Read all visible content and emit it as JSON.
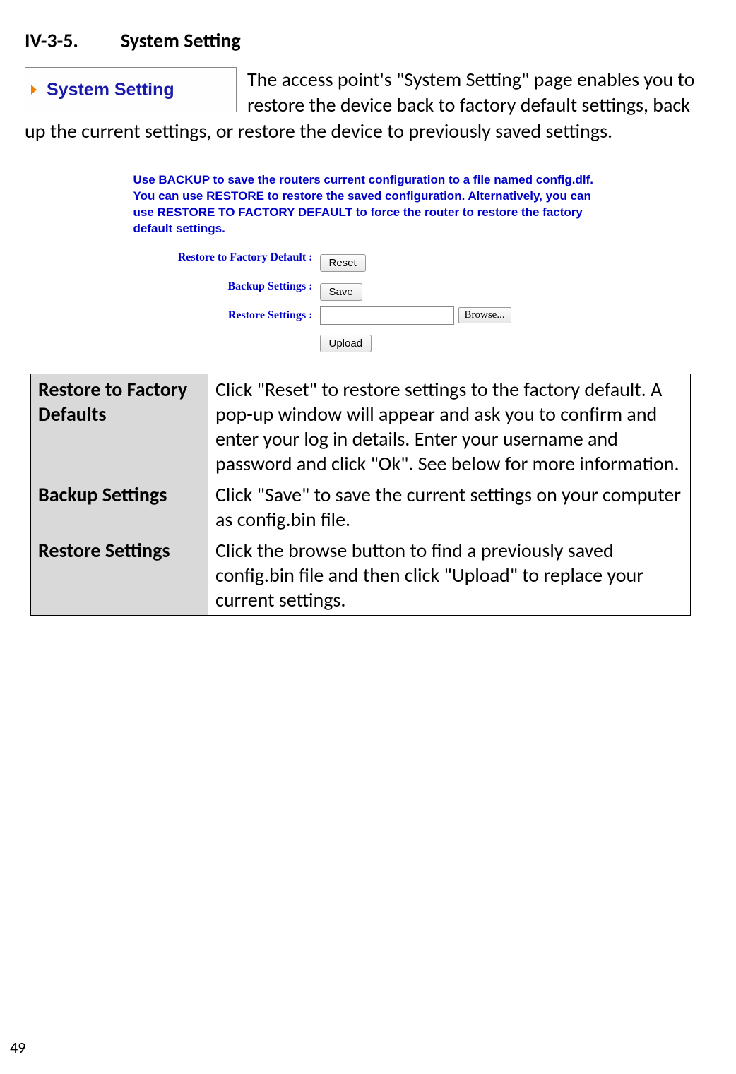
{
  "heading": {
    "num": "IV-3-5.",
    "title": "System Setting"
  },
  "box": {
    "label": "System Setting"
  },
  "intro": "The access point's \"System Setting\" page enables you to restore the device back to factory default settings, back up the current settings, or restore the device to previously saved settings.",
  "ui": {
    "help": "Use BACKUP to save the routers current configuration to a file named config.dlf. You can use RESTORE to restore the saved configuration. Alternatively, you can use RESTORE TO FACTORY DEFAULT to force the router to restore the factory default settings.",
    "rows": {
      "restoreFactory": {
        "label": "Restore to Factory Default :",
        "button": "Reset"
      },
      "backup": {
        "label": "Backup Settings :",
        "button": "Save"
      },
      "restore": {
        "label": "Restore Settings :",
        "browse": "Browse...",
        "upload": "Upload"
      }
    }
  },
  "table": {
    "r1": {
      "key": "Restore to Factory Defaults",
      "val": "Click \"Reset\" to restore settings to the factory default. A pop-up window will appear and ask you to confirm and enter your log in details. Enter your username and password and click \"Ok\". See below for more information."
    },
    "r2": {
      "key": "Backup Settings",
      "val": "Click \"Save\" to save the current settings on your computer as config.bin file."
    },
    "r3": {
      "key": "Restore Settings",
      "val": "Click the browse button to find a previously saved config.bin file and then click \"Upload\" to replace your current settings."
    }
  },
  "pageNumber": "49"
}
